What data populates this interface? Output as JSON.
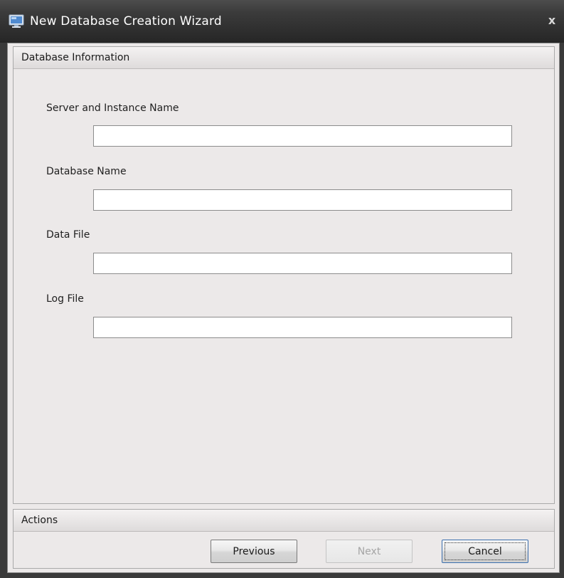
{
  "window": {
    "title": "New Database Creation Wizard",
    "close_symbol": "x",
    "icon": "monitor-app-icon"
  },
  "database_info": {
    "header": "Database Information",
    "fields": [
      {
        "label": "Server and Instance Name",
        "value": ""
      },
      {
        "label": "Database Name",
        "value": ""
      },
      {
        "label": "Data File",
        "value": ""
      },
      {
        "label": "Log File",
        "value": ""
      }
    ]
  },
  "actions": {
    "header": "Actions",
    "previous_label": "Previous",
    "next_label": "Next",
    "next_enabled": false,
    "cancel_label": "Cancel"
  },
  "colors": {
    "titlebar": "#2e2e2e",
    "panel_background": "#ece9e9",
    "focus_border": "#3c6fae",
    "disabled_text": "#a5a5a5"
  }
}
